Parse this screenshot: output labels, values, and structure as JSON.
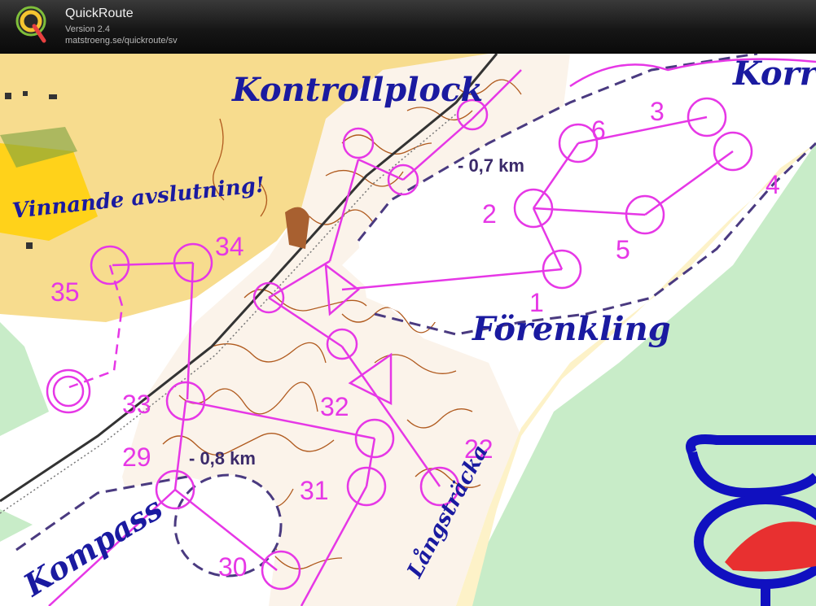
{
  "app": {
    "title": "QuickRoute",
    "version": "Version 2.4",
    "url": "matstroeng.se/quickroute/sv",
    "logo_letter": "Q"
  },
  "map": {
    "area_labels": {
      "kontrollplock": "Kontrollplock",
      "korr": "Korr",
      "vinnande": "Vinnande avslutning!",
      "forenkling": "Förenkling",
      "kompass": "Kompass",
      "langstracka": "Långsträcka"
    },
    "distances": {
      "top": "- 0,7 km",
      "left": "- 0,8 km"
    },
    "controls": [
      "1",
      "2",
      "3",
      "4",
      "5",
      "6",
      "22",
      "29",
      "30",
      "31",
      "32",
      "33",
      "34",
      "35"
    ],
    "colors": {
      "course": "#e637e6",
      "label": "#1a1aa0",
      "open_land": "#f7dc8e",
      "forest_green": "#c8ecc8",
      "contour": "#b05a1e"
    }
  }
}
